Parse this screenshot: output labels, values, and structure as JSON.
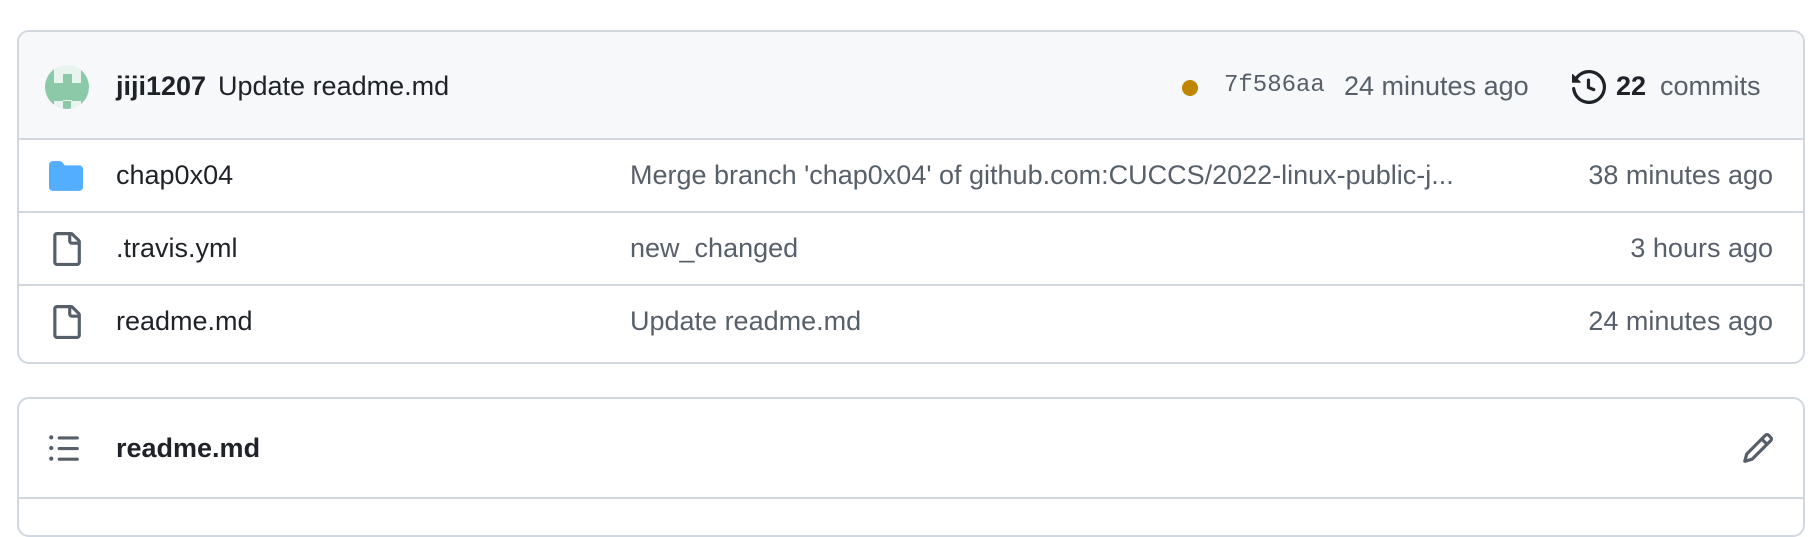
{
  "latest_commit": {
    "author": "jiji1207",
    "message": "Update readme.md",
    "status_color": "#bf8700",
    "sha": "7f586aa",
    "time": "24 minutes ago",
    "commits_count": "22",
    "commits_label": "commits",
    "icons": {
      "avatar": "identicon-avatar",
      "history": "history-icon"
    }
  },
  "files": [
    {
      "type": "folder",
      "icon": "folder-icon",
      "name": "chap0x04",
      "message": "Merge branch 'chap0x04' of github.com:CUCCS/2022-linux-public-j...",
      "time": "38 minutes ago"
    },
    {
      "type": "file",
      "icon": "file-icon",
      "name": ".travis.yml",
      "message": "new_changed",
      "time": "3 hours ago"
    },
    {
      "type": "file",
      "icon": "file-icon",
      "name": "readme.md",
      "message": "Update readme.md",
      "time": "24 minutes ago"
    }
  ],
  "readme": {
    "title": "readme.md",
    "icons": {
      "toc": "list-icon",
      "edit": "pencil-icon"
    }
  },
  "colors": {
    "folder": "#54aeff",
    "border": "#d0d7de",
    "muted": "#57606a",
    "header_bg": "#f6f8fa"
  }
}
